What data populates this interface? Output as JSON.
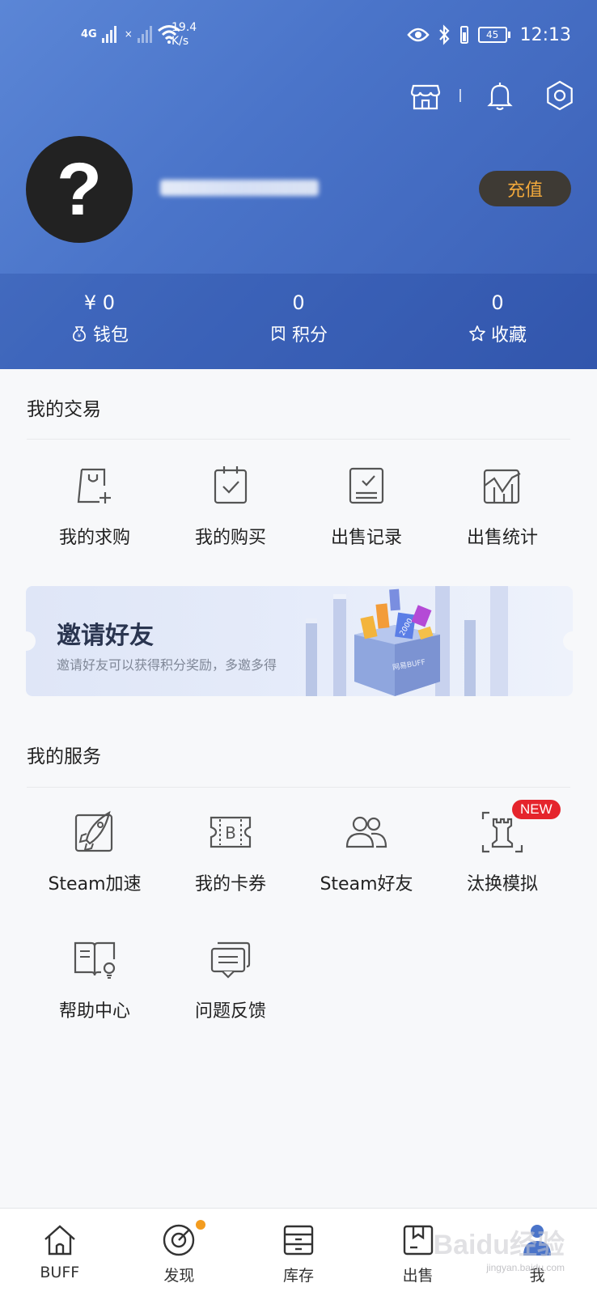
{
  "status_bar": {
    "network": "4G",
    "speed_value": "19.4",
    "speed_unit": "K/s",
    "battery": "45",
    "time": "12:13"
  },
  "header": {
    "avatar_glyph": "?",
    "recharge_label": "充值",
    "stats": [
      {
        "value": "¥ 0",
        "label": "钱包",
        "icon": "wallet-icon"
      },
      {
        "value": "0",
        "label": "积分",
        "icon": "points-icon"
      },
      {
        "value": "0",
        "label": "收藏",
        "icon": "star-icon"
      }
    ]
  },
  "trade": {
    "title": "我的交易",
    "items": [
      {
        "label": "我的求购",
        "icon": "bag-plus-icon"
      },
      {
        "label": "我的购买",
        "icon": "clipboard-check-icon"
      },
      {
        "label": "出售记录",
        "icon": "list-check-icon"
      },
      {
        "label": "出售统计",
        "icon": "chart-icon"
      }
    ]
  },
  "invite": {
    "title": "邀请好友",
    "subtitle": "邀请好友可以获得积分奖励，多邀多得",
    "art_box_text": "网易BUFF",
    "art_card_text": "2000"
  },
  "services": {
    "title": "我的服务",
    "items": [
      {
        "label": "Steam加速",
        "icon": "rocket-icon"
      },
      {
        "label": "我的卡券",
        "icon": "coupon-icon"
      },
      {
        "label": "Steam好友",
        "icon": "friends-icon"
      },
      {
        "label": "汰换模拟",
        "icon": "chess-rook-icon",
        "badge": "NEW"
      },
      {
        "label": "帮助中心",
        "icon": "help-book-icon"
      },
      {
        "label": "问题反馈",
        "icon": "feedback-icon"
      }
    ]
  },
  "bottom_nav": [
    {
      "label": "BUFF",
      "icon": "home-icon"
    },
    {
      "label": "发现",
      "icon": "discover-icon",
      "dot": true
    },
    {
      "label": "库存",
      "icon": "inventory-icon"
    },
    {
      "label": "出售",
      "icon": "sell-box-icon"
    },
    {
      "label": "我",
      "icon": "me-icon",
      "active": true
    }
  ],
  "watermark": {
    "text": "Baidu经验",
    "sub": "jingyan.baidu.com"
  },
  "colors": {
    "header_blue": "#4a74c9",
    "recharge_text": "#f3a93b",
    "badge_red": "#e5242c",
    "nav_dot": "#f39c1f"
  }
}
